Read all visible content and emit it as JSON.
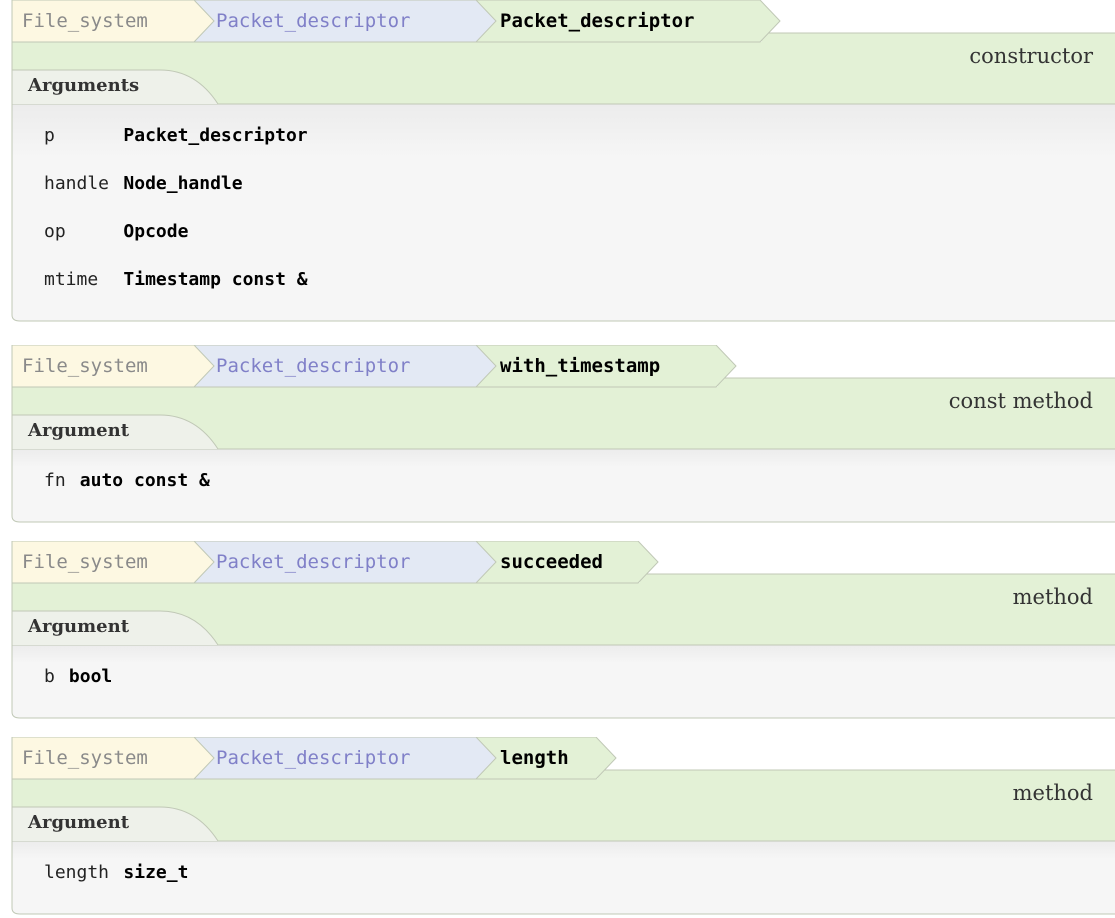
{
  "entries": [
    {
      "crumbs": [
        "File_system",
        "Packet_descriptor",
        "Packet_descriptor"
      ],
      "kind": "constructor",
      "args_label": "Arguments",
      "args": [
        {
          "name": "p",
          "type": "Packet_descriptor"
        },
        {
          "name": "handle",
          "type": "Node_handle"
        },
        {
          "name": "op",
          "type": "Opcode"
        },
        {
          "name": "mtime",
          "type": "Timestamp const &"
        }
      ]
    },
    {
      "crumbs": [
        "File_system",
        "Packet_descriptor",
        "with_timestamp"
      ],
      "kind": "const method",
      "args_label": "Argument",
      "args": [
        {
          "name": "fn",
          "type": "auto const &"
        }
      ]
    },
    {
      "crumbs": [
        "File_system",
        "Packet_descriptor",
        "succeeded"
      ],
      "kind": "method",
      "args_label": "Argument",
      "args": [
        {
          "name": "b",
          "type": "bool"
        }
      ]
    },
    {
      "crumbs": [
        "File_system",
        "Packet_descriptor",
        "length"
      ],
      "kind": "method",
      "args_label": "Argument",
      "args": [
        {
          "name": "length",
          "type": "size_t"
        }
      ]
    }
  ],
  "colors": {
    "namespace_fill": "#fdf8e2",
    "class_fill": "#e3e9f4",
    "member_fill": "#e3f1d6",
    "panel_fill": "#f6f6f6",
    "border": "#c0c8b6"
  }
}
